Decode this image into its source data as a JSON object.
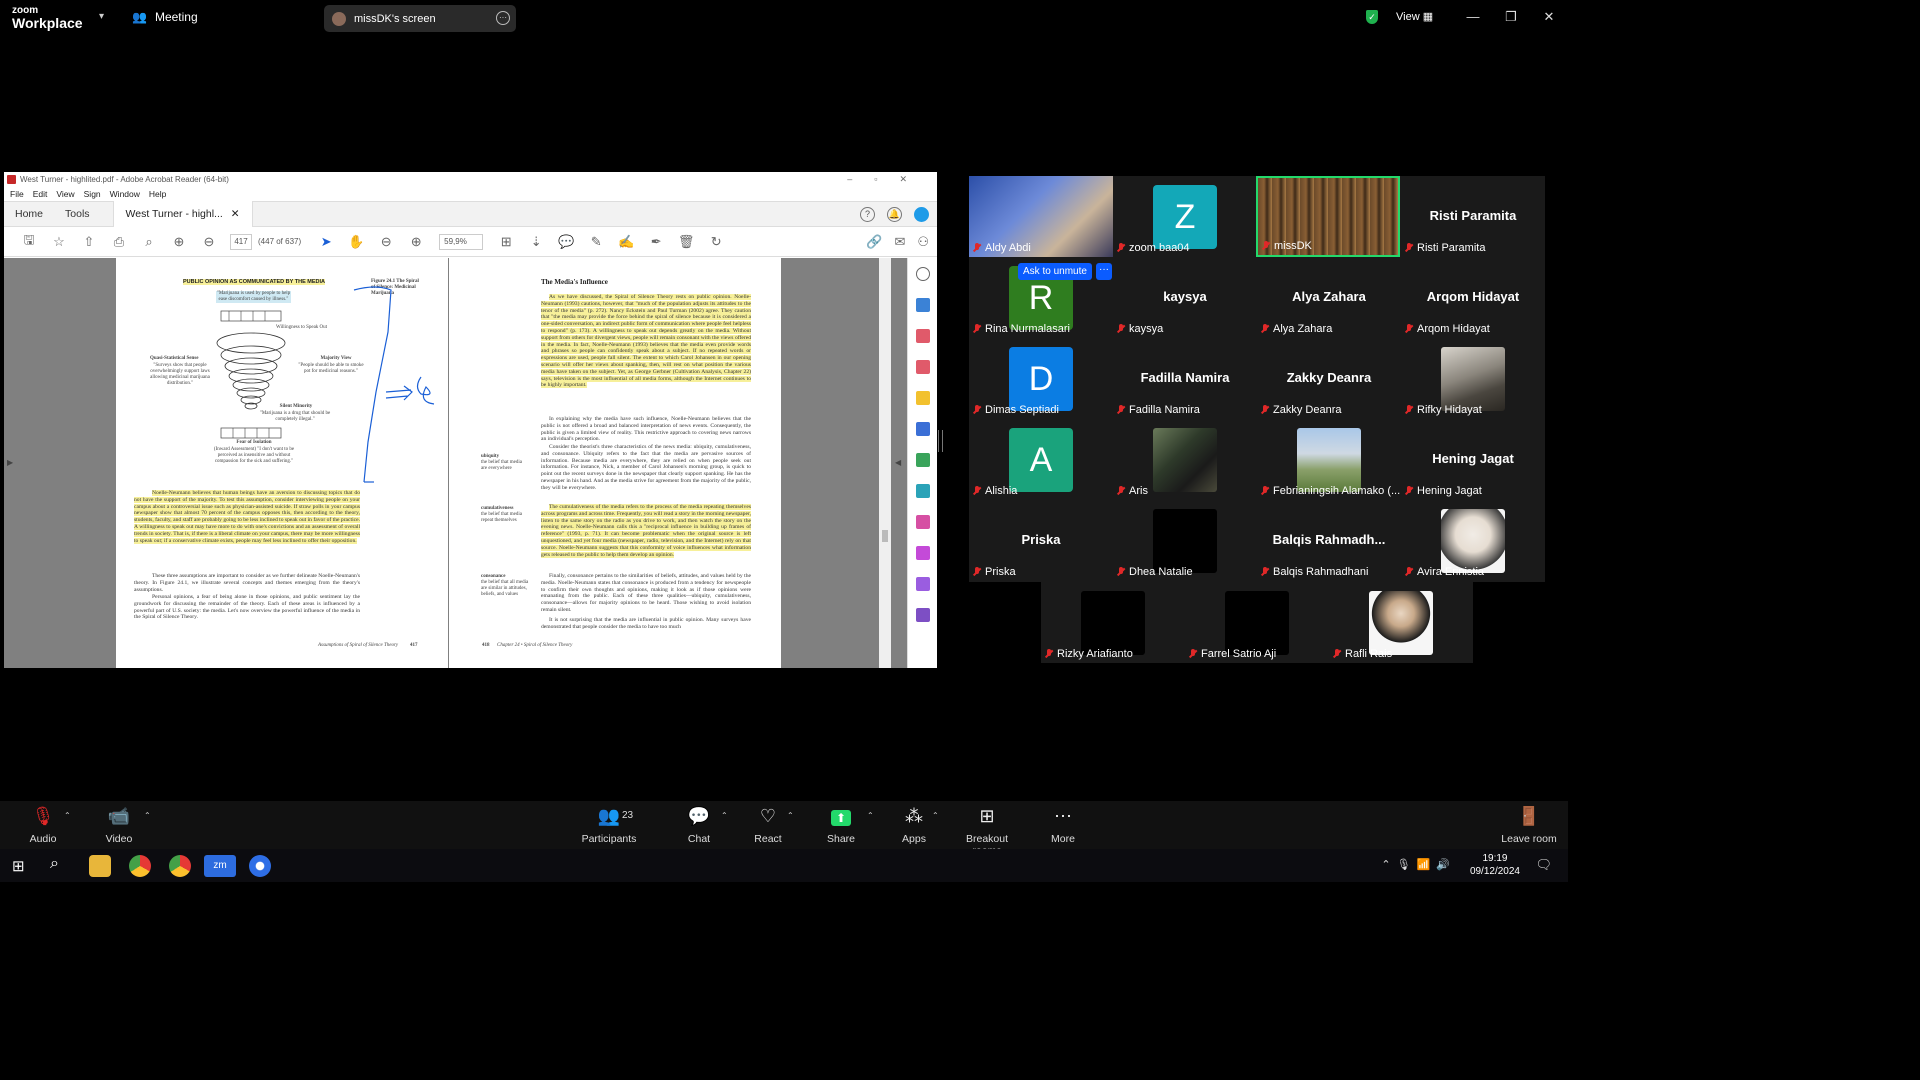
{
  "zoom": {
    "brand_top": "zoom",
    "brand_bottom": "Workplace",
    "meeting_label": "Meeting",
    "share_label": "missDK's screen",
    "view_label": "View",
    "win_controls": [
      "—",
      "❐",
      "✕"
    ]
  },
  "acrobat": {
    "title": "West Turner - highlited.pdf - Adobe Acrobat Reader (64-bit)",
    "menu": [
      "File",
      "Edit",
      "View",
      "Sign",
      "Window",
      "Help"
    ],
    "tabs": [
      "Home",
      "Tools"
    ],
    "doc_tab": "West Turner - highl...",
    "page_current": "417",
    "page_count": "(447 of 637)",
    "zoom_level": "59,9%",
    "left_page": {
      "figure_title": "PUBLIC OPINION AS COMMUNICATED BY THE MEDIA",
      "figure_caption": "Figure 24.1 The Spiral of Silence: Medicinal Marijuana",
      "quote_top": "\"Marijuana is used by people to help ease discomfort caused by illness.\"",
      "willingness": "Willingness to Speak Out",
      "quasi_label": "Quasi-Statistical Sense",
      "quasi_text": "\"Surveys show that people overwhelmingly support laws allowing medicinal marijuana distribution.\"",
      "majority_label": "Majority View",
      "majority_text": "\"People should be able to smoke pot for medicinal reasons.\"",
      "silent_label": "Silent Minority",
      "silent_text": "\"Marijuana is a drug that should be completely illegal.\"",
      "fear_label": "Fear of Isolation",
      "fear_text": "(Inward Assessment) \"I don't want to be perceived as insensitive and without compassion for the sick and suffering.\"",
      "body_para1": "Noelle-Neumann believes that human beings have an aversion to discussing topics that do not have the support of the majority. To test this assumption, consider interviewing people on your campus about a controversial issue such as physician-assisted suicide. If straw polls in your campus newspaper show that almost 70 percent of the campus opposes this, then according to the theory, students, faculty, and staff are probably going to be less inclined to speak out in favor of the practice. A willingness to speak out may have more to do with one's convictions and an assessment of overall trends in society. That is, if there is a liberal climate on your campus, there may be more willingness to speak out; if a conservative climate exists, people may feel less inclined to offer their opposition.",
      "body_para2": "These three assumptions are important to consider as we further delineate Noelle-Neumann's theory. In Figure 24.1, we illustrate several concepts and themes emerging from the theory's assumptions.",
      "body_para3": "Personal opinions, a fear of being alone in those opinions, and public sentiment lay the groundwork for discussing the remainder of the theory. Each of these areas is influenced by a powerful part of U.S. society: the media. Let's now overview the powerful influence of the media in the Spiral of Silence Theory.",
      "footer": "Assumptions of Spiral of Silence Theory",
      "page_number": "417"
    },
    "right_page": {
      "heading": "The Media's Influence",
      "para1": "As we have discussed, the Spiral of Silence Theory rests on public opinion. Noelle-Neumann (1993) cautions, however, that \"much of the population adjusts its attitudes to the tenor of the media\" (p. 272). Nancy Eckstein and Paul Turman (2002) agree. They caution that \"the media may provide the force behind the spiral of silence because it is considered a one-sided conversation, an indirect public form of communication where people feel helpless to respond\" (p. 173). A willingness to speak out depends greatly on the media. Without support from others for divergent views, people will remain consonant with the views offered in the media. In fact, Noelle-Neumann (1993) believes that the media even provide words and phrases so people can confidently speak about a subject. If no repeated words or expressions are used, people fall silent. The extent to which Carol Johansen in our opening scenario will offer her views about spanking, then, will rest on what position the various media have taken on the subject. Yet, as George Gerbner (Cultivation Analysis, Chapter 22) says, television is the most influential of all media forms, although the Internet continues to be highly important.",
      "para2": "In explaining why the media have such influence, Noelle-Neumann believes that the public is not offered a broad and balanced interpretation of news events. Consequently, the public is given a limited view of reality. This restrictive approach to covering news narrows an individual's perception.",
      "para3": "Consider the theorist's three characteristics of the news media: ubiquity, cumulativeness, and consonance. Ubiquity refers to the fact that the media are pervasive sources of information. Because media are everywhere, they are relied on when people seek out information. For instance, Nick, a member of Carol Johansen's morning group, is quick to point out the recent surveys done in the newspaper that clearly support spanking. He has the newspaper in his hand. And as the media strive for agreement from the majority of the public, they will be everywhere.",
      "para4": "The cumulativeness of the media refers to the process of the media repeating themselves across programs and across time. Frequently, you will read a story in the morning newspaper, listen to the same story on the radio as you drive to work, and then watch the story on the evening news. Noelle-Neumann calls this a \"reciprocal influence in building up frames of reference\" (1993, p. 71). It can become problematic when the original source is left unquestioned, and yet four media (newspaper, radio, television, and the Internet) rely on that source. Noelle-Neumann suggests that this conformity of voice influences what information gets released to the public to help them develop an opinion.",
      "para5": "Finally, consonance pertains to the similarities of beliefs, attitudes, and values held by the media. Noelle-Neumann states that consonance is produced from a tendency for newspeople to confirm their own thoughts and opinions, making it look as if those opinions were emanating from the public. Each of these three qualities—ubiquity, cumulativeness, consonance—allows for majority opinions to be heard. Those wishing to avoid isolation remain silent.",
      "para6": "It is not surprising that the media are influential in public opinion. Many surveys have demonstrated that people consider the media to have too much",
      "note_ubiquity_term": "ubiquity",
      "note_ubiquity_def": "the belief that media are everywhere",
      "note_cumulative_term": "cumulativeness",
      "note_cumulative_def": "the belief that media repeat themselves",
      "note_consonance_term": "consonance",
      "note_consonance_def": "the belief that all media are similar in attitudes, beliefs, and values",
      "footer_page": "418",
      "footer_text": "Chapter 24 • Spiral of Silence Theory"
    }
  },
  "gallery": {
    "tiles": [
      {
        "name": "Aldy Abdi",
        "kind": "video"
      },
      {
        "name": "zoom baa04",
        "kind": "letter",
        "letter": "Z",
        "color": "#13a8b8"
      },
      {
        "name": "missDK",
        "kind": "video",
        "active": true
      },
      {
        "name": "Risti Paramita",
        "kind": "name",
        "big": "Risti Paramita"
      },
      {
        "name": "Rina Nurmalasari",
        "kind": "letter",
        "letter": "R",
        "color": "#2f7d1f"
      },
      {
        "name": "kaysya",
        "kind": "name",
        "big": "kaysya"
      },
      {
        "name": "Alya Zahara",
        "kind": "name",
        "big": "Alya Zahara"
      },
      {
        "name": "Arqom Hidayat",
        "kind": "name",
        "big": "Arqom Hidayat"
      },
      {
        "name": "Dimas Septiadi",
        "kind": "letter",
        "letter": "D",
        "color": "#0b7de3"
      },
      {
        "name": "Fadilla Namira",
        "kind": "name",
        "big": "Fadilla Namira"
      },
      {
        "name": "Zakky Deanra",
        "kind": "name",
        "big": "Zakky Deanra"
      },
      {
        "name": "Rifky Hidayat",
        "kind": "photo"
      },
      {
        "name": "Alishia",
        "kind": "letter",
        "letter": "A",
        "color": "#1aa37c"
      },
      {
        "name": "Aris",
        "kind": "photo"
      },
      {
        "name": "Febrianingsih Alamako (...",
        "kind": "photo"
      },
      {
        "name": "Hening Jagat",
        "kind": "name",
        "big": "Hening Jagat"
      },
      {
        "name": "Priska",
        "kind": "name",
        "big": "Priska"
      },
      {
        "name": "Dhea Natalie",
        "kind": "black"
      },
      {
        "name": "Balqis Rahmadhani",
        "kind": "name",
        "big": "Balqis  Rahmadh..."
      },
      {
        "name": "Avira Erinistia",
        "kind": "photo"
      }
    ],
    "row6": [
      {
        "name": "Rizky Ariafianto"
      },
      {
        "name": "Farrel Satrio Aji"
      },
      {
        "name": "Rafli Rais"
      }
    ],
    "ask_unmute": "Ask to unmute",
    "more_dots": "···"
  },
  "controls": {
    "audio": "Audio",
    "video": "Video",
    "participants": "Participants",
    "participant_count": "23",
    "chat": "Chat",
    "react": "React",
    "share": "Share",
    "apps": "Apps",
    "breakout": "Breakout rooms",
    "more": "More",
    "leave": "Leave room"
  },
  "taskbar": {
    "time": "19:19",
    "date": "09/12/2024"
  },
  "colors": {
    "accent": "#0b5cff",
    "share_green": "#23d96b",
    "muted_red": "#e02828",
    "highlight_yellow": "#f7f09a"
  }
}
